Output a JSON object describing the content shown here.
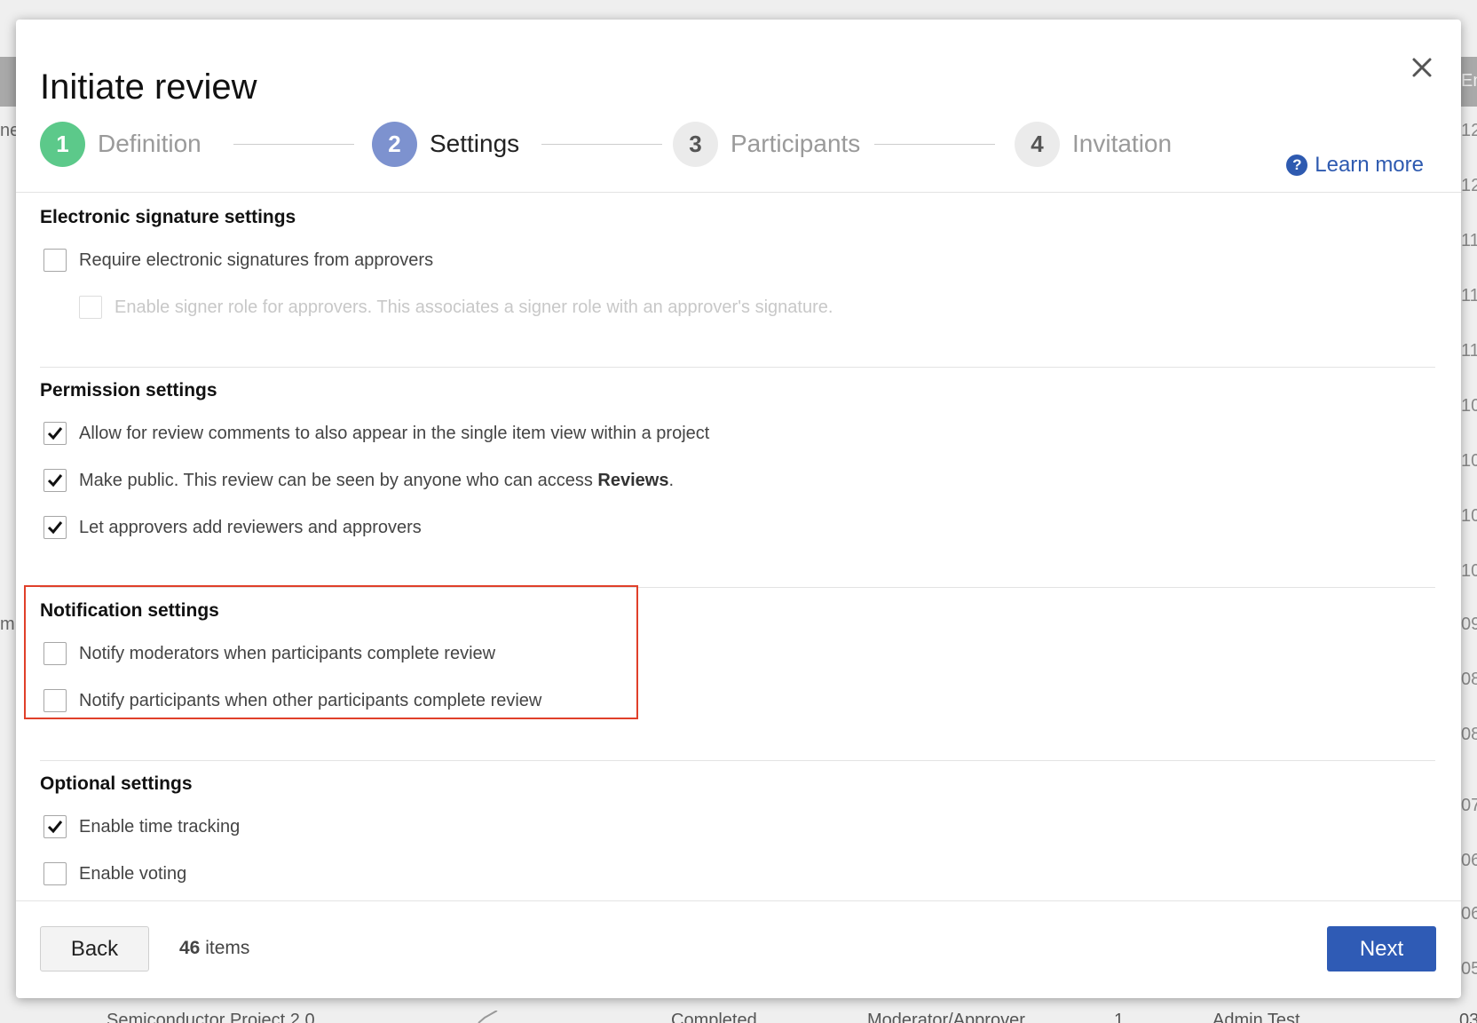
{
  "background": {
    "left_fragments": [
      "ne",
      "m"
    ],
    "right_fragments": [
      "En",
      "12",
      "12",
      "11",
      "11",
      "11",
      "10",
      "10",
      "10",
      "10",
      "09",
      "08",
      "08",
      "07",
      "06",
      "06",
      "05"
    ],
    "bottom_row": [
      "Semiconductor Project 2.0",
      "Completed",
      "Moderator/Approver",
      "1",
      "Admin Test",
      "03"
    ]
  },
  "modal": {
    "title": "Initiate review",
    "learn_more": "Learn more",
    "steps": [
      {
        "number": "1",
        "label": "Definition",
        "state": "done"
      },
      {
        "number": "2",
        "label": "Settings",
        "state": "active"
      },
      {
        "number": "3",
        "label": "Participants",
        "state": "pending"
      },
      {
        "number": "4",
        "label": "Invitation",
        "state": "pending"
      }
    ],
    "sections": {
      "esig": {
        "title": "Electronic signature settings",
        "options": [
          {
            "label": "Require electronic signatures from approvers",
            "checked": false,
            "disabled": false
          },
          {
            "label": "Enable signer role for approvers. This associates a signer role with an approver's signature.",
            "checked": false,
            "disabled": true
          }
        ]
      },
      "permission": {
        "title": "Permission settings",
        "options": [
          {
            "label": "Allow for review comments to also appear in the single item view within a project",
            "checked": true
          },
          {
            "label_prefix": "Make public. This review can be seen by anyone who can access ",
            "label_bold": "Reviews",
            "label_suffix": ".",
            "checked": true
          },
          {
            "label": "Let approvers add reviewers and approvers",
            "checked": true
          }
        ]
      },
      "notification": {
        "title": "Notification settings",
        "options": [
          {
            "label": "Notify moderators when participants complete review",
            "checked": false
          },
          {
            "label": "Notify participants when other participants complete review",
            "checked": false
          }
        ]
      },
      "optional": {
        "title": "Optional settings",
        "options": [
          {
            "label": "Enable time tracking",
            "checked": true
          },
          {
            "label": "Enable voting",
            "checked": false
          }
        ]
      }
    },
    "footer": {
      "back_label": "Back",
      "items_count": "46",
      "items_label": " items",
      "next_label": "Next"
    },
    "colors": {
      "step_done": "#5cc98a",
      "step_active": "#7d92cf",
      "step_pending": "#ebebeb",
      "primary": "#2f5bb5",
      "highlight": "#e0402a"
    }
  }
}
